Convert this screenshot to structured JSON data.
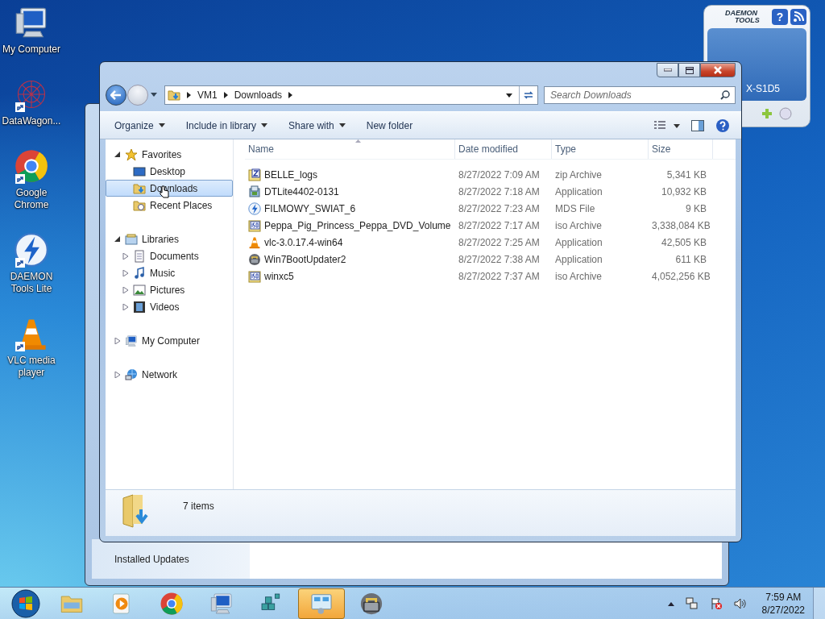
{
  "desktop_icons": [
    {
      "label": "My Computer",
      "kind": "computer",
      "shortcut": false
    },
    {
      "label": "DataWagon...",
      "kind": "network-art",
      "shortcut": true
    },
    {
      "label": "Google Chrome",
      "kind": "chrome",
      "shortcut": true
    },
    {
      "label": "DAEMON Tools Lite",
      "kind": "daemon",
      "shortcut": true
    },
    {
      "label": "VLC media player",
      "kind": "vlc",
      "shortcut": true
    }
  ],
  "gadget": {
    "logo_line1": "DAEMON",
    "logo_line2": "TOOLS",
    "help": "?",
    "drive_label": "X-S1D5"
  },
  "back_window": {
    "sidebar_link": "Installed Updates"
  },
  "explorer": {
    "breadcrumb": [
      "VM1",
      "Downloads"
    ],
    "search": {
      "placeholder": "Search Downloads"
    },
    "toolbar": [
      {
        "label": "Organize",
        "dropdown": true
      },
      {
        "label": "Include in library",
        "dropdown": true
      },
      {
        "label": "Share with",
        "dropdown": true
      },
      {
        "label": "New folder",
        "dropdown": false
      }
    ],
    "nav": [
      {
        "label": "Favorites",
        "kind": "star",
        "expandable": true,
        "expanded": true,
        "selected": false,
        "children": [
          {
            "label": "Desktop",
            "kind": "desktop",
            "expandable": false,
            "selected": false
          },
          {
            "label": "Downloads",
            "kind": "downloads",
            "expandable": false,
            "selected": true
          },
          {
            "label": "Recent Places",
            "kind": "recent",
            "expandable": false,
            "selected": false
          }
        ]
      },
      {
        "label": "Libraries",
        "kind": "library",
        "expandable": true,
        "expanded": true,
        "selected": false,
        "children": [
          {
            "label": "Documents",
            "kind": "documents",
            "expandable": true,
            "expanded": false,
            "selected": false
          },
          {
            "label": "Music",
            "kind": "music",
            "expandable": true,
            "expanded": false,
            "selected": false
          },
          {
            "label": "Pictures",
            "kind": "pictures",
            "expandable": true,
            "expanded": false,
            "selected": false
          },
          {
            "label": "Videos",
            "kind": "videos",
            "expandable": true,
            "expanded": false,
            "selected": false
          }
        ]
      },
      {
        "label": "My Computer",
        "kind": "computer",
        "expandable": true,
        "expanded": false,
        "selected": false
      },
      {
        "label": "Network",
        "kind": "network",
        "expandable": true,
        "expanded": false,
        "selected": false
      }
    ],
    "columns": [
      "Name",
      "Date modified",
      "Type",
      "Size"
    ],
    "files": [
      {
        "name": "BELLE_logs",
        "date": "8/27/2022 7:09 AM",
        "type": "zip Archive",
        "size": "5,341 KB",
        "kind": "zip"
      },
      {
        "name": "DTLite4402-0131",
        "date": "8/27/2022 7:18 AM",
        "type": "Application",
        "size": "10,932 KB",
        "kind": "installer"
      },
      {
        "name": "FILMOWY_SWIAT_6",
        "date": "8/27/2022 7:23 AM",
        "type": "MDS File",
        "size": "9 KB",
        "kind": "daemon"
      },
      {
        "name": "Peppa_Pig_Princess_Peppa_DVD_Volume",
        "date": "8/27/2022 7:17 AM",
        "type": "iso Archive",
        "size": "3,338,084 KB",
        "kind": "iso"
      },
      {
        "name": "vlc-3.0.17.4-win64",
        "date": "8/27/2022 7:25 AM",
        "type": "Application",
        "size": "42,505 KB",
        "kind": "vlc"
      },
      {
        "name": "Win7BootUpdater2",
        "date": "8/27/2022 7:38 AM",
        "type": "Application",
        "size": "611 KB",
        "kind": "updater"
      },
      {
        "name": "winxc5",
        "date": "8/27/2022 7:37 AM",
        "type": "iso Archive",
        "size": "4,052,256 KB",
        "kind": "iso"
      }
    ],
    "status": "7 items"
  },
  "taskbar": {
    "apps": [
      {
        "kind": "explorer",
        "selected": false
      },
      {
        "kind": "media",
        "selected": false
      },
      {
        "kind": "chrome",
        "selected": false
      },
      {
        "kind": "computer",
        "selected": false
      },
      {
        "kind": "cubes",
        "selected": false
      },
      {
        "kind": "panel",
        "selected": true
      },
      {
        "kind": "updater",
        "selected": false
      }
    ],
    "time": "7:59 AM",
    "date": "8/27/2022"
  }
}
